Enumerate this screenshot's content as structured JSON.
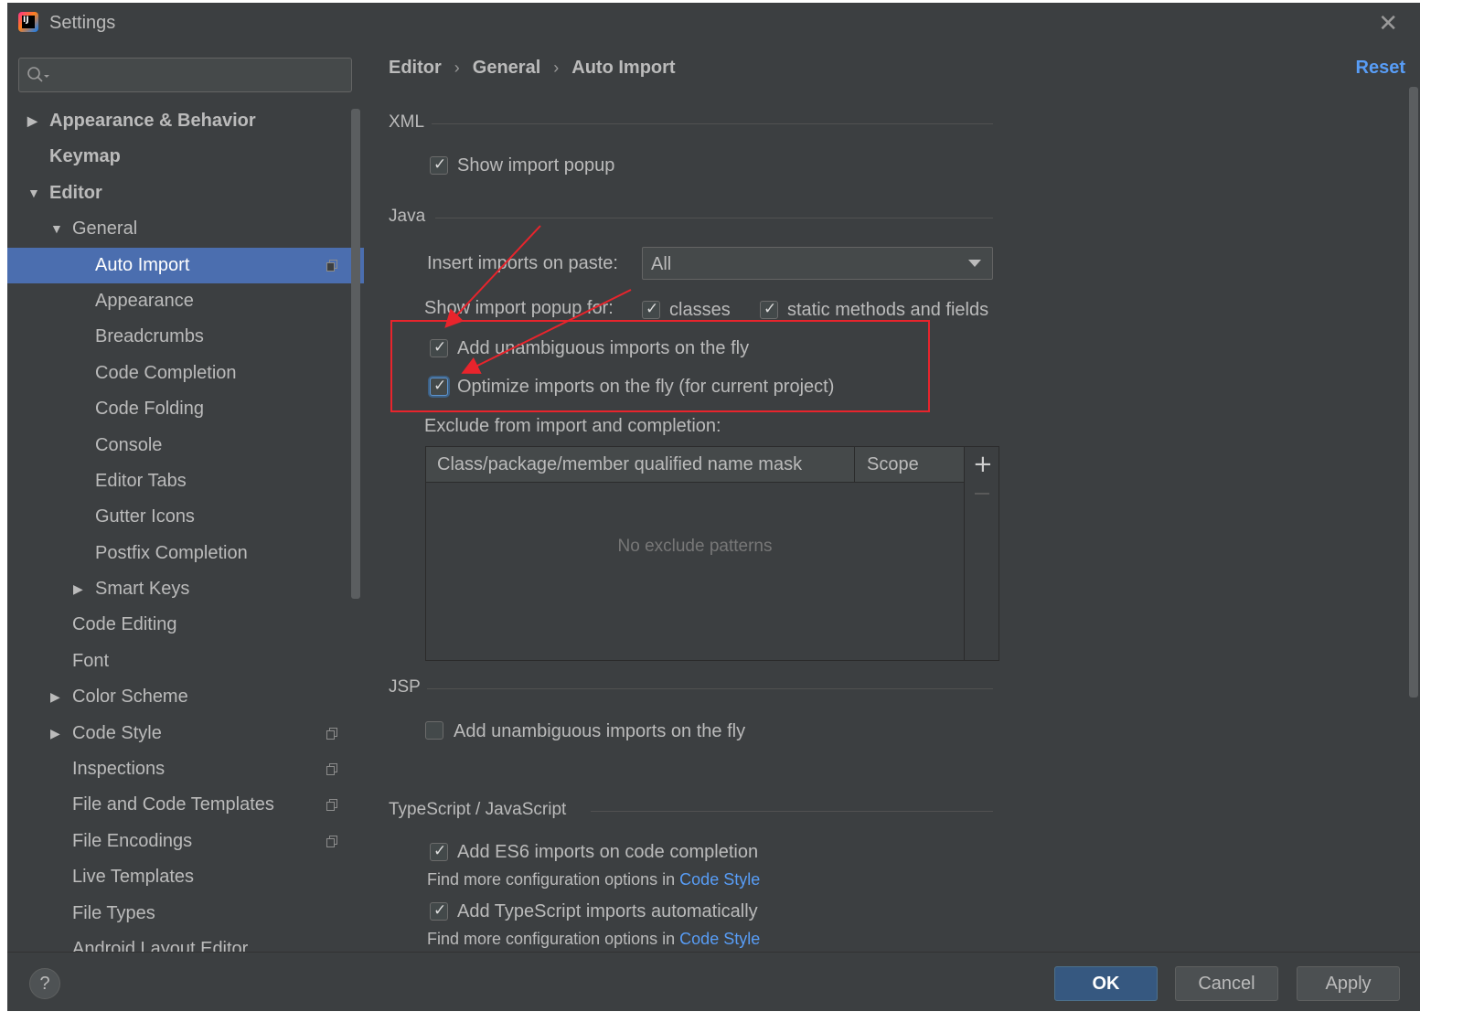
{
  "window": {
    "title": "Settings",
    "close_glyph": "✕"
  },
  "search": {
    "placeholder": "",
    "value": ""
  },
  "sidebar": {
    "items": [
      {
        "label": "Appearance & Behavior",
        "arrow": "▶"
      },
      {
        "label": "Keymap",
        "arrow": ""
      },
      {
        "label": "Editor",
        "arrow": "▼"
      },
      {
        "label": "General",
        "arrow": "▼"
      },
      {
        "label": "Auto Import",
        "arrow": ""
      },
      {
        "label": "Appearance",
        "arrow": ""
      },
      {
        "label": "Breadcrumbs",
        "arrow": ""
      },
      {
        "label": "Code Completion",
        "arrow": ""
      },
      {
        "label": "Code Folding",
        "arrow": ""
      },
      {
        "label": "Console",
        "arrow": ""
      },
      {
        "label": "Editor Tabs",
        "arrow": ""
      },
      {
        "label": "Gutter Icons",
        "arrow": ""
      },
      {
        "label": "Postfix Completion",
        "arrow": ""
      },
      {
        "label": "Smart Keys",
        "arrow": "▶"
      },
      {
        "label": "Code Editing",
        "arrow": ""
      },
      {
        "label": "Font",
        "arrow": ""
      },
      {
        "label": "Color Scheme",
        "arrow": "▶"
      },
      {
        "label": "Code Style",
        "arrow": "▶"
      },
      {
        "label": "Inspections",
        "arrow": ""
      },
      {
        "label": "File and Code Templates",
        "arrow": ""
      },
      {
        "label": "File Encodings",
        "arrow": ""
      },
      {
        "label": "Live Templates",
        "arrow": ""
      },
      {
        "label": "File Types",
        "arrow": ""
      },
      {
        "label": "Android Layout Editor",
        "arrow": ""
      }
    ]
  },
  "breadcrumb": {
    "part1": "Editor",
    "part2": "General",
    "part3": "Auto Import",
    "sep": "›"
  },
  "reset_label": "Reset",
  "xml": {
    "header": "XML",
    "show_import_popup": {
      "label": "Show import popup",
      "checked": true
    }
  },
  "java": {
    "header": "Java",
    "insert_label": "Insert imports on paste:",
    "insert_value": "All",
    "show_popup_for": "Show import popup for:",
    "classes": {
      "label": "classes",
      "checked": true
    },
    "static": {
      "label": "static methods and fields",
      "checked": true
    },
    "add_unambiguous": {
      "label": "Add unambiguous imports on the fly",
      "checked": true
    },
    "optimize": {
      "label": "Optimize imports on the fly (for current project)",
      "checked": true
    },
    "exclude_label": "Exclude from import and completion:",
    "table": {
      "col1": "Class/package/member qualified name mask",
      "col2": "Scope",
      "empty": "No exclude patterns",
      "add": "+"
    }
  },
  "jsp": {
    "header": "JSP",
    "add_unambiguous": {
      "label": "Add unambiguous imports on the fly",
      "checked": false
    }
  },
  "ts": {
    "header": "TypeScript / JavaScript",
    "es6": {
      "label": "Add ES6 imports on code completion",
      "checked": true
    },
    "more1": "Find more configuration options in",
    "link1": "Code Style",
    "ts_auto": {
      "label": "Add TypeScript imports automatically",
      "checked": true
    },
    "more2": "Find more configuration options in",
    "link2": "Code Style"
  },
  "footer": {
    "help": "?",
    "ok": "OK",
    "cancel": "Cancel",
    "apply": "Apply"
  },
  "colors": {
    "accent": "#4b6eaf",
    "link": "#589df6",
    "annotation": "#e8242c",
    "background": "#3c3f41"
  }
}
